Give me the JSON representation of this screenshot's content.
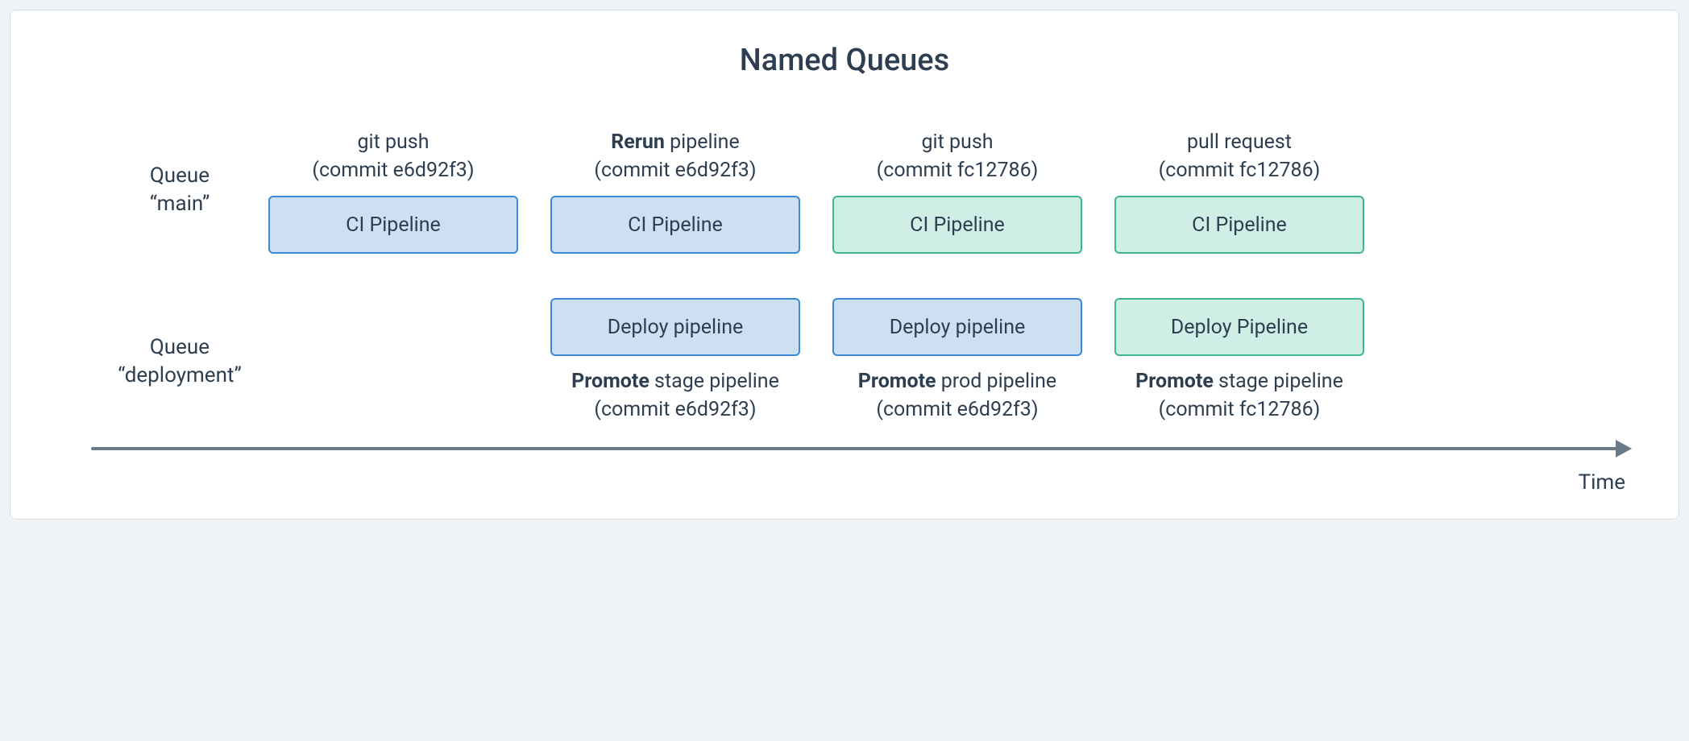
{
  "title": "Named Queues",
  "queues": {
    "main": {
      "label_line1": "Queue",
      "label_line2": "“main”"
    },
    "deployment": {
      "label_line1": "Queue",
      "label_line2": "“deployment”"
    }
  },
  "axis": {
    "label": "Time"
  },
  "columns": [
    {
      "top_caption_prefix": "",
      "top_caption_bold": "",
      "top_caption_suffix": "git push",
      "top_commit": "(commit e6d92f3)",
      "top_box": "CI Pipeline",
      "top_color": "blue",
      "has_bottom": false
    },
    {
      "top_caption_prefix": "",
      "top_caption_bold": "Rerun",
      "top_caption_suffix": " pipeline",
      "top_commit": "(commit e6d92f3)",
      "top_box": "CI Pipeline",
      "top_color": "blue",
      "has_bottom": true,
      "bottom_box": "Deploy pipeline",
      "bottom_color": "blue",
      "bottom_caption_bold": "Promote",
      "bottom_caption_suffix": " stage pipeline",
      "bottom_commit": "(commit e6d92f3)"
    },
    {
      "top_caption_prefix": "",
      "top_caption_bold": "",
      "top_caption_suffix": "git push",
      "top_commit": "(commit fc12786)",
      "top_box": "CI Pipeline",
      "top_color": "green",
      "has_bottom": true,
      "bottom_box": "Deploy pipeline",
      "bottom_color": "blue",
      "bottom_caption_bold": "Promote",
      "bottom_caption_suffix": " prod pipeline",
      "bottom_commit": "(commit e6d92f3)"
    },
    {
      "top_caption_prefix": "",
      "top_caption_bold": "",
      "top_caption_suffix": "pull request",
      "top_commit": "(commit fc12786)",
      "top_box": "CI Pipeline",
      "top_color": "green",
      "has_bottom": true,
      "bottom_box": "Deploy Pipeline",
      "bottom_color": "green",
      "bottom_caption_bold": "Promote",
      "bottom_caption_suffix": " stage pipeline",
      "bottom_commit": "(commit fc12786)"
    }
  ]
}
